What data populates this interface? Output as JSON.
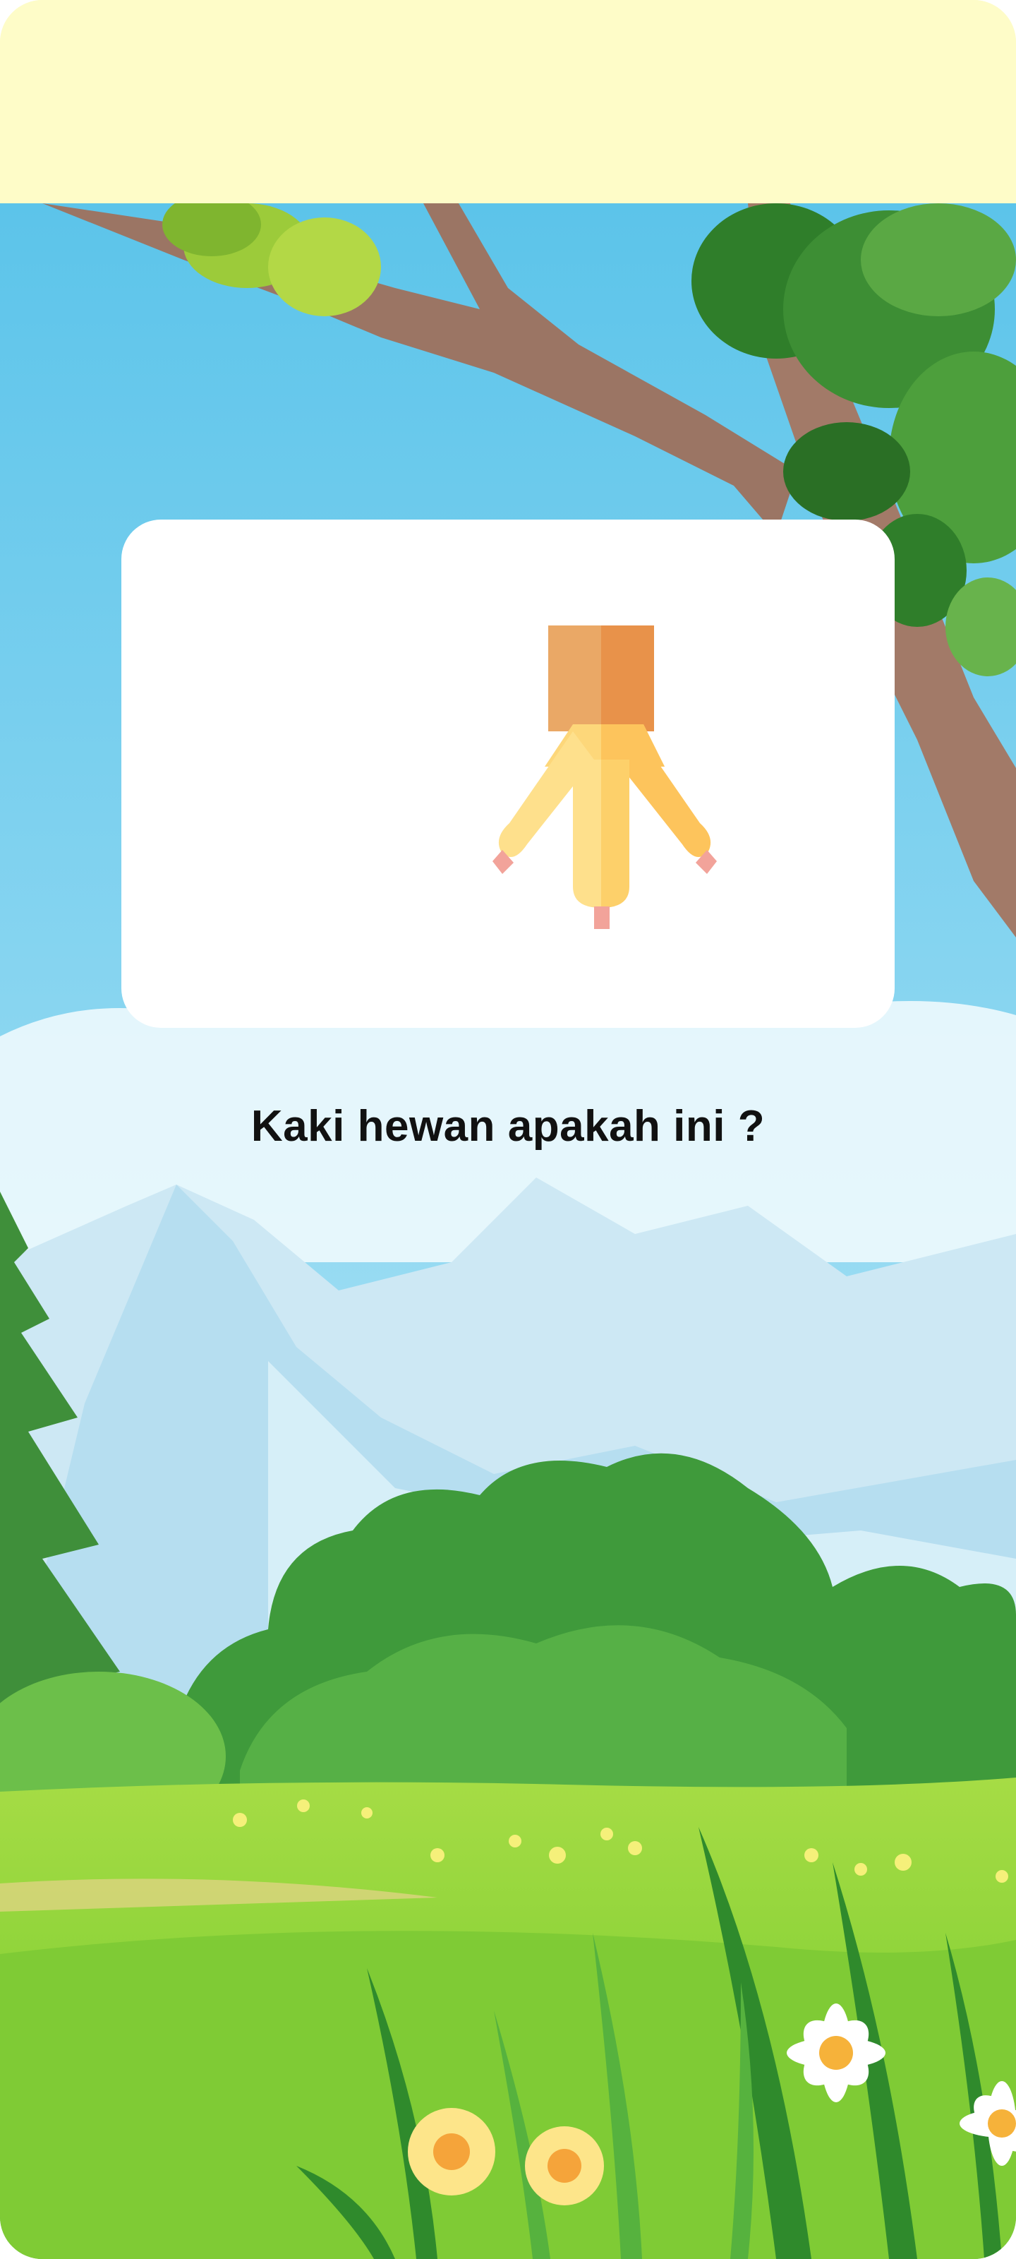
{
  "question": {
    "text": "Kaki hewan apakah ini ?",
    "image_icon": "chicken-foot-icon"
  },
  "colors": {
    "top_bar": "#fefcc8",
    "card": "#ffffff",
    "sky": "#63c8ec",
    "grass": "#8fd43a",
    "foot_light": "#fdd77a",
    "foot_dark": "#e8924a",
    "claw": "#f2a39a"
  }
}
